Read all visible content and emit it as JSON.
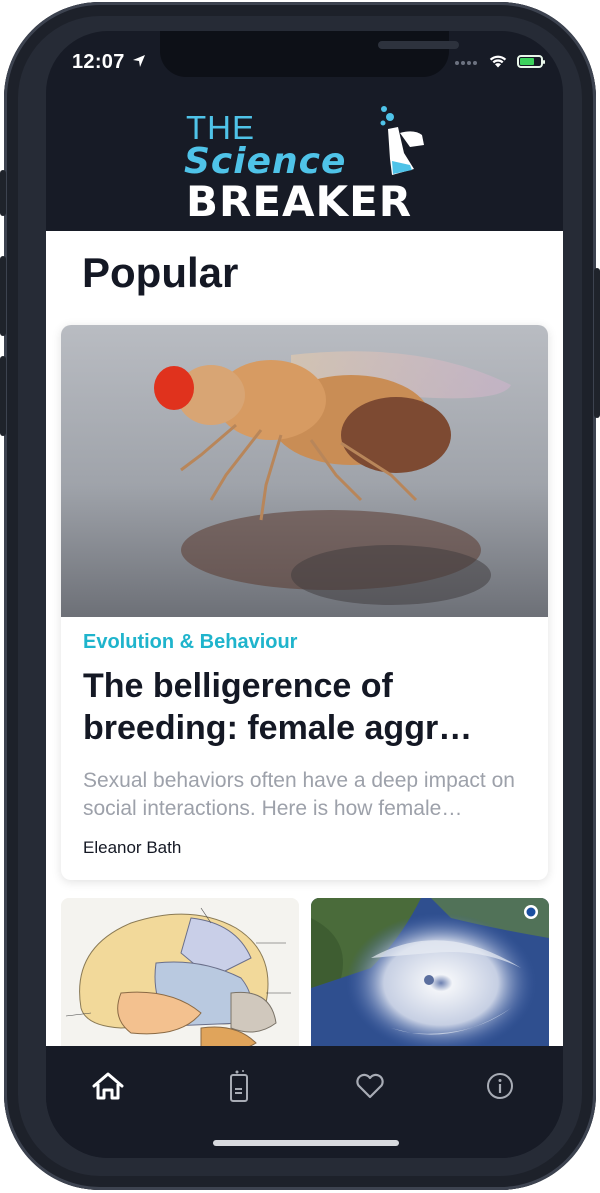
{
  "status_bar": {
    "time": "12:07"
  },
  "header": {
    "logo_line1": "THE",
    "logo_line2": "Science",
    "logo_line3": "BREAKER"
  },
  "section": {
    "heading": "Popular"
  },
  "featured_article": {
    "category": "Evolution & Behaviour",
    "title": "The belligerence of breeding: female aggr…",
    "excerpt": "Sexual behaviors often have a deep impact on social interactions. Here is how female…",
    "author": "Eleanor Bath"
  },
  "tabbar": {
    "items": [
      {
        "icon": "home-icon",
        "active": true
      },
      {
        "icon": "clipboard-icon",
        "active": false
      },
      {
        "icon": "heart-icon",
        "active": false
      },
      {
        "icon": "info-icon",
        "active": false
      }
    ]
  },
  "colors": {
    "accent": "#1fb4cc",
    "logo_blue": "#4fc3e8",
    "dark_bg": "#171b26"
  }
}
